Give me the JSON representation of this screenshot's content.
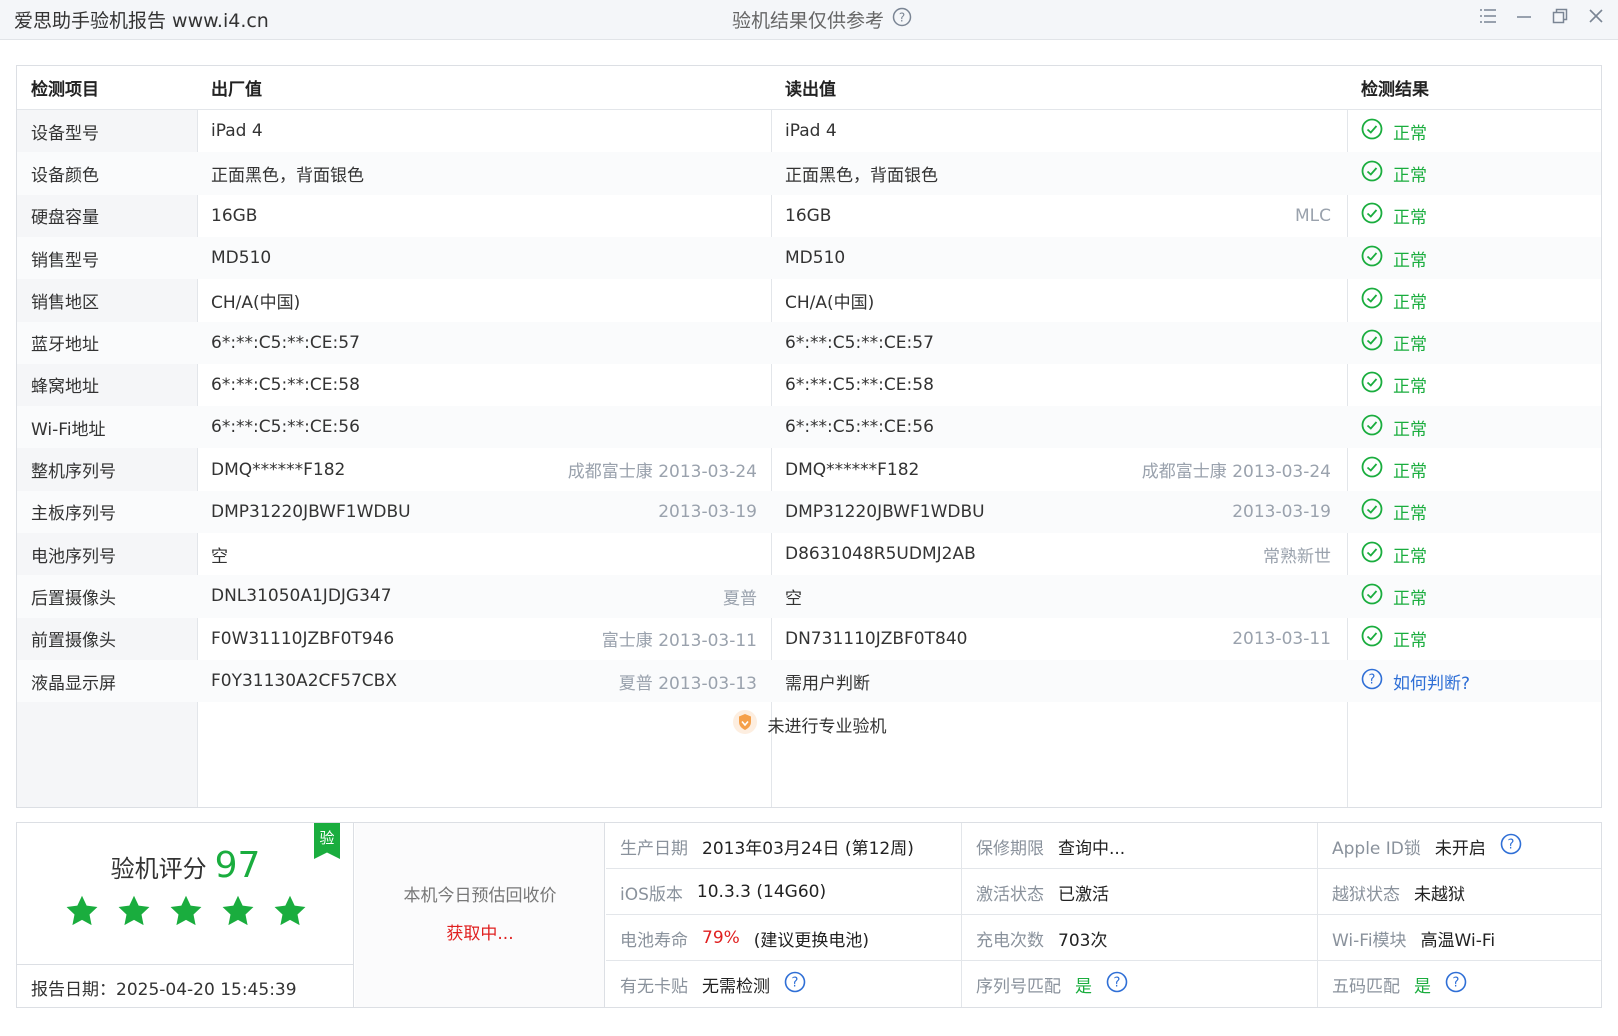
{
  "titlebar": {
    "app_title": "爱思助手验机报告 www.i4.cn",
    "center_title": "验机结果仅供参考"
  },
  "table": {
    "headers": [
      "检测项目",
      "出厂值",
      "读出值",
      "检测结果"
    ],
    "rows": [
      {
        "item": "设备型号",
        "factory": "iPad 4",
        "factory_note": "",
        "read": "iPad 4",
        "read_note": "",
        "result": "正常"
      },
      {
        "item": "设备颜色",
        "factory": "正面黑色，背面银色",
        "factory_note": "",
        "read": "正面黑色，背面银色",
        "read_note": "",
        "result": "正常"
      },
      {
        "item": "硬盘容量",
        "factory": "16GB",
        "factory_note": "",
        "read": "16GB",
        "read_note": "MLC",
        "result": "正常"
      },
      {
        "item": "销售型号",
        "factory": "MD510",
        "factory_note": "",
        "read": "MD510",
        "read_note": "",
        "result": "正常"
      },
      {
        "item": "销售地区",
        "factory": "CH/A(中国)",
        "factory_note": "",
        "read": "CH/A(中国)",
        "read_note": "",
        "result": "正常"
      },
      {
        "item": "蓝牙地址",
        "factory": "6*:**:C5:**:CE:57",
        "factory_note": "",
        "read": "6*:**:C5:**:CE:57",
        "read_note": "",
        "result": "正常"
      },
      {
        "item": "蜂窝地址",
        "factory": "6*:**:C5:**:CE:58",
        "factory_note": "",
        "read": "6*:**:C5:**:CE:58",
        "read_note": "",
        "result": "正常"
      },
      {
        "item": "Wi-Fi地址",
        "factory": "6*:**:C5:**:CE:56",
        "factory_note": "",
        "read": "6*:**:C5:**:CE:56",
        "read_note": "",
        "result": "正常"
      },
      {
        "item": "整机序列号",
        "factory": "DMQ******F182",
        "factory_note": "成都富士康 2013-03-24",
        "read": "DMQ******F182",
        "read_note": "成都富士康 2013-03-24",
        "result": "正常"
      },
      {
        "item": "主板序列号",
        "factory": "DMP31220JBWF1WDBU",
        "factory_note": "2013-03-19",
        "read": "DMP31220JBWF1WDBU",
        "read_note": "2013-03-19",
        "result": "正常"
      },
      {
        "item": "电池序列号",
        "factory": "空",
        "factory_note": "",
        "read": "D8631048R5UDMJ2AB",
        "read_note": "常熟新世",
        "result": "正常"
      },
      {
        "item": "后置摄像头",
        "factory": "DNL31050A1JDJG347",
        "factory_note": "夏普",
        "read": "空",
        "read_note": "",
        "result": "正常"
      },
      {
        "item": "前置摄像头",
        "factory": "F0W31110JZBF0T946",
        "factory_note": "富士康 2013-03-11",
        "read": "DN731110JZBF0T840",
        "read_note": "2013-03-11",
        "result": "正常"
      },
      {
        "item": "液晶显示屏",
        "factory": "F0Y31130A2CF57CBX",
        "factory_note": "夏普 2013-03-13",
        "read": "需用户判断",
        "read_note": "",
        "result": "如何判断?"
      }
    ],
    "notice": "未进行专业验机"
  },
  "score": {
    "label": "验机评分",
    "value": "97",
    "stars": 5,
    "badge": "验",
    "report_date": "报告日期：2025-04-20 15:45:39"
  },
  "price": {
    "label": "本机今日预估回收价",
    "value": "获取中..."
  },
  "info": {
    "production_date_k": "生产日期",
    "production_date_v": "2013年03月24日 (第12周)",
    "warranty_k": "保修期限",
    "warranty_v": "查询中...",
    "appleid_k": "Apple ID锁",
    "appleid_v": "未开启",
    "ios_k": "iOS版本",
    "ios_v": "10.3.3 (14G60)",
    "activation_k": "激活状态",
    "activation_v": "已激活",
    "jailbreak_k": "越狱状态",
    "jailbreak_v": "未越狱",
    "battery_k": "电池寿命",
    "battery_pct": "79%",
    "battery_note": "(建议更换电池)",
    "charge_k": "充电次数",
    "charge_v": "703次",
    "wifi_k": "Wi-Fi模块",
    "wifi_v": "高温Wi-Fi",
    "card_k": "有无卡贴",
    "card_v": "无需检测",
    "serial_match_k": "序列号匹配",
    "serial_match_v": "是",
    "five_code_k": "五码匹配",
    "five_code_v": "是"
  },
  "colors": {
    "ok_green": "#1aad3e",
    "link_blue": "#2f6fd6",
    "warn_red": "#e02020"
  }
}
